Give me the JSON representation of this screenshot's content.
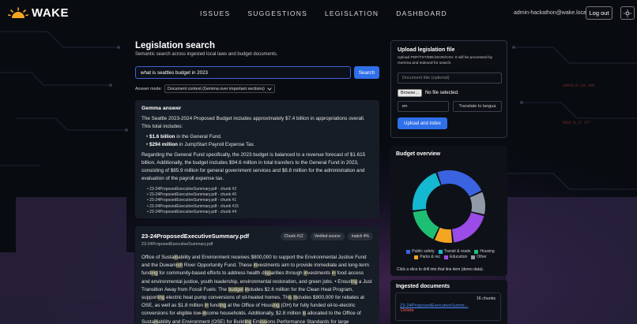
{
  "header": {
    "brand": "WAKE",
    "nav": [
      "ISSUES",
      "SUGGESTIONS",
      "LEGISLATION",
      "DASHBOARD"
    ],
    "user_email": "admin-hackathon@wake.local",
    "logout_label": "Log out"
  },
  "search": {
    "title": "Legislation search",
    "subtitle": "Semantic search across ingested local laws and budget documents.",
    "query": "what is seattles budget in 2023",
    "button_label": "Search",
    "mode_label": "Answer mode:",
    "mode_value": "Document context (Gemma over important sections)"
  },
  "answer": {
    "heading": "Gemma answer",
    "intro": "The Seattle 2023-2024 Proposed Budget includes approximately $7.4 billion in appropriations overall. This total includes:",
    "bullets": [
      {
        "bold": "$1.6 billion",
        "rest": " in the General Fund."
      },
      {
        "bold": "$294 million",
        "rest": " in JumpStart Payroll Expense Tax."
      }
    ],
    "detail": "Regarding the General Fund specifically, the 2023 budget is balanced to a revenue forecast of $1.615 billion. Additionally, the budget includes $94.6 million in total transfers to the General Fund in 2023, consisting of $85.9 million for general government services and $8.8 million for the administration and evaluation of the payroll expense tax.",
    "sources": [
      "23-24ProposedExecutiveSummary.pdf - chunk #2",
      "23-24ProposedExecutiveSummary.pdf - chunk #0",
      "23-24ProposedExecutiveSummary.pdf - chunk #1",
      "23-24ProposedExecutiveSummary.pdf - chunk #15",
      "23-24ProposedExecutiveSummary.pdf - chunk #4"
    ]
  },
  "result": {
    "title": "23-24ProposedExecutiveSummary.pdf",
    "subtitle": "23-24ProposedExecutiveSummary.pdf",
    "badges": [
      "Chunk #12",
      "Verified source",
      "match 4%"
    ],
    "body_segments": [
      [
        "Office of Susta",
        false
      ],
      [
        "in",
        true
      ],
      [
        "ability and Environment receives $800,000 to support the Environmental Justice Fund and the Duwam",
        false
      ],
      [
        "ish",
        true
      ],
      [
        " River Opportunity Fund. These ",
        false
      ],
      [
        "in",
        true
      ],
      [
        "vestments aim to provide immediate and long-term fund",
        false
      ],
      [
        "ing",
        true
      ],
      [
        " for community-based efforts to address health d",
        false
      ],
      [
        "isp",
        true
      ],
      [
        "arities through ",
        false
      ],
      [
        "in",
        true
      ],
      [
        "vestments ",
        false
      ],
      [
        "in",
        true
      ],
      [
        " food access and environmental justice, youth leadership, environmental restoration, and green jobs. • Ensur",
        false
      ],
      [
        "ing",
        true
      ],
      [
        " a Just Transition Away from Fossil Fuels: The ",
        false
      ],
      [
        "budget",
        true
      ],
      [
        " ",
        false
      ],
      [
        "in",
        true
      ],
      [
        "cludes $2.6 million for the Clean Heat Program, support",
        false
      ],
      [
        "ing",
        true
      ],
      [
        " electric heat pump conversions of oil-heated homes. Th",
        false
      ],
      [
        "is",
        true
      ],
      [
        " ",
        false
      ],
      [
        "in",
        true
      ],
      [
        "cludes $800,000 for rebates at OSE, as well as $1.8 million ",
        false
      ],
      [
        "in",
        true
      ],
      [
        " fund",
        false
      ],
      [
        "ing",
        true
      ],
      [
        " at the Office of Hous",
        false
      ],
      [
        "ing",
        true
      ],
      [
        " (OH) for fully funded oil-to-electric conversions for eligible low-",
        false
      ],
      [
        "in",
        true
      ],
      [
        "come households. Additionally, $2.8 million ",
        false
      ],
      [
        "is",
        true
      ],
      [
        " allocated to the Office of Susta",
        false
      ],
      [
        "in",
        true
      ],
      [
        "ability and Environment (OSE) for Build",
        false
      ],
      [
        "ing",
        true
      ],
      [
        " Em",
        false
      ],
      [
        "iss",
        true
      ],
      [
        "ions Performance Standards for large commercial",
        false
      ]
    ]
  },
  "upload": {
    "title": "Upload legislation file",
    "description": "Upload PDF/TXT/MD/JSON/CSV. It will be processed by Gemma and indexed for search.",
    "title_placeholder": "Document title (optional)",
    "browse_label": "Browse...",
    "file_status": "No file selected.",
    "language_value": "en",
    "translate_label": "Translate to langua",
    "index_label": "Upload and index"
  },
  "budget": {
    "title": "Budget overview",
    "note": "Click a slice to drill into that line item (demo data).",
    "colors": {
      "public_safety": "#3a63e0",
      "transit_roads": "#14b8d0",
      "housing": "#1fbf73",
      "parks_rec": "#f4a623",
      "education": "#9b4be8",
      "other": "#8f99a8"
    },
    "chart_data": {
      "type": "pie",
      "categories": [
        "Public safety",
        "Transit & roads",
        "Housing",
        "Parks & rec",
        "Education",
        "Other"
      ],
      "values": [
        22,
        20,
        15,
        8,
        18,
        10
      ]
    }
  },
  "documents": {
    "title": "Ingested documents",
    "items": [
      {
        "name": "23-24ProposedExecutiveSumm...",
        "chunks": "16 chunks",
        "delete_label": "Delete"
      }
    ]
  }
}
